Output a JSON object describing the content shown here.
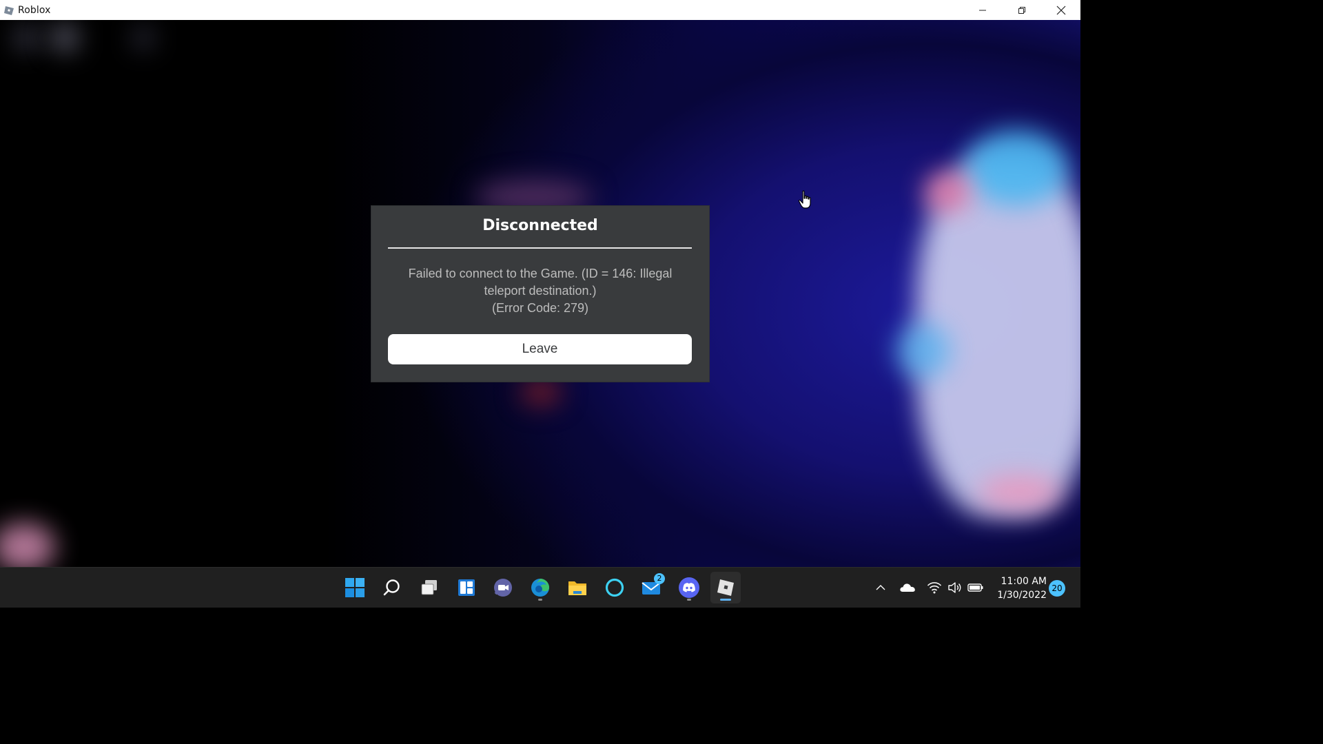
{
  "window": {
    "title": "Roblox",
    "controls": [
      "minimize",
      "restore",
      "close"
    ]
  },
  "dialog": {
    "title": "Disconnected",
    "message_line1": "Failed to connect to the Game. (ID = 146: Illegal",
    "message_line2": "teleport destination.)",
    "message_line3": "(Error Code: 279)",
    "button_label": "Leave"
  },
  "taskbar": {
    "apps": [
      {
        "name": "start-icon"
      },
      {
        "name": "search-icon"
      },
      {
        "name": "task-view-icon"
      },
      {
        "name": "widgets-icon"
      },
      {
        "name": "teams-chat-icon"
      },
      {
        "name": "edge-icon",
        "running": true
      },
      {
        "name": "file-explorer-icon"
      },
      {
        "name": "cortana-icon"
      },
      {
        "name": "mail-icon",
        "badge": "2"
      },
      {
        "name": "discord-icon",
        "running": true
      },
      {
        "name": "roblox-icon",
        "running": true,
        "active": true
      }
    ],
    "mail_badge": "2",
    "tray": [
      "chevron-up-icon",
      "onedrive-icon",
      "wifi-icon",
      "volume-icon",
      "battery-icon"
    ],
    "time": "11:00 AM",
    "date": "1/30/2022",
    "notifications": "20"
  },
  "colors": {
    "dialog_bg": "#393b3d",
    "taskbar_bg": "#202020",
    "accent": "#4cc2ff"
  }
}
